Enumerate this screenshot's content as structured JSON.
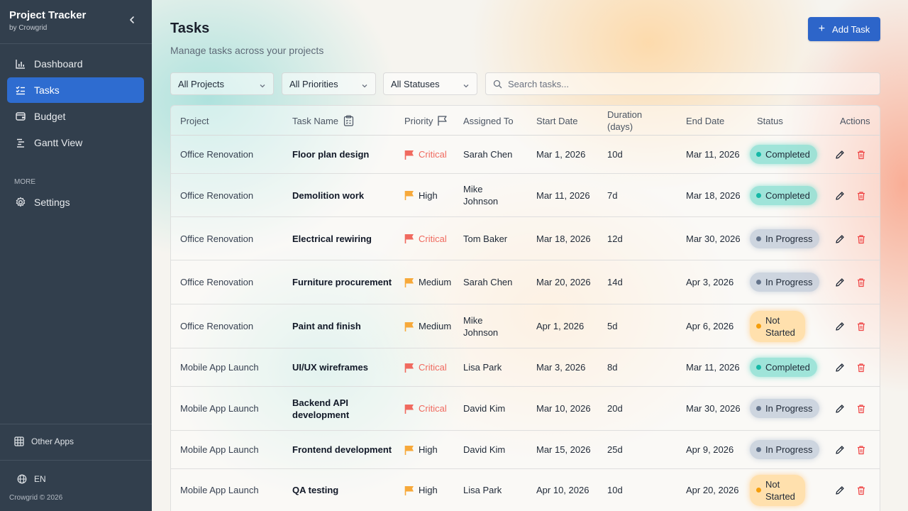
{
  "app": {
    "title": "Project Tracker",
    "subtitle": "by Crowgrid"
  },
  "sidebar": {
    "items": [
      {
        "label": "Dashboard",
        "icon": "bar-chart-icon"
      },
      {
        "label": "Tasks",
        "icon": "checklist-icon",
        "active": true
      },
      {
        "label": "Budget",
        "icon": "wallet-icon"
      },
      {
        "label": "Gantt View",
        "icon": "gantt-icon"
      }
    ],
    "section_more": "MORE",
    "more_items": [
      {
        "label": "Settings",
        "icon": "gear-icon"
      }
    ],
    "other_apps": "Other Apps",
    "language": "EN",
    "copyright": "Crowgrid © 2026"
  },
  "header": {
    "title": "Tasks",
    "subtitle": "Manage tasks across your projects",
    "add_button": "Add Task"
  },
  "filters": {
    "project": "All Projects",
    "priority": "All Priorities",
    "status": "All Statuses",
    "search_placeholder": "Search tasks..."
  },
  "table": {
    "columns": [
      "Project",
      "Task Name",
      "Priority",
      "Assigned To",
      "Start Date",
      "Duration (days)",
      "End Date",
      "Status",
      "Actions"
    ],
    "rows": [
      {
        "project": "Office Renovation",
        "task": "Floor plan design",
        "priority": "Critical",
        "assigned": "Sarah Chen",
        "start": "Mar 1, 2026",
        "duration": "10d",
        "end": "Mar 11, 2026",
        "status": "Completed"
      },
      {
        "project": "Office Renovation",
        "task": "Demolition work",
        "priority": "High",
        "assigned": "Mike Johnson",
        "start": "Mar 11, 2026",
        "duration": "7d",
        "end": "Mar 18, 2026",
        "status": "Completed"
      },
      {
        "project": "Office Renovation",
        "task": "Electrical rewiring",
        "priority": "Critical",
        "assigned": "Tom Baker",
        "start": "Mar 18, 2026",
        "duration": "12d",
        "end": "Mar 30, 2026",
        "status": "In Progress"
      },
      {
        "project": "Office Renovation",
        "task": "Furniture procurement",
        "priority": "Medium",
        "assigned": "Sarah Chen",
        "start": "Mar 20, 2026",
        "duration": "14d",
        "end": "Apr 3, 2026",
        "status": "In Progress"
      },
      {
        "project": "Office Renovation",
        "task": "Paint and finish",
        "priority": "Medium",
        "assigned": "Mike Johnson",
        "start": "Apr 1, 2026",
        "duration": "5d",
        "end": "Apr 6, 2026",
        "status": "Not Started"
      },
      {
        "project": "Mobile App Launch",
        "task": "UI/UX wireframes",
        "priority": "Critical",
        "assigned": "Lisa Park",
        "start": "Mar 3, 2026",
        "duration": "8d",
        "end": "Mar 11, 2026",
        "status": "Completed"
      },
      {
        "project": "Mobile App Launch",
        "task": "Backend API development",
        "priority": "Critical",
        "assigned": "David Kim",
        "start": "Mar 10, 2026",
        "duration": "20d",
        "end": "Mar 30, 2026",
        "status": "In Progress"
      },
      {
        "project": "Mobile App Launch",
        "task": "Frontend development",
        "priority": "High",
        "assigned": "David Kim",
        "start": "Mar 15, 2026",
        "duration": "25d",
        "end": "Apr 9, 2026",
        "status": "In Progress"
      },
      {
        "project": "Mobile App Launch",
        "task": "QA testing",
        "priority": "High",
        "assigned": "Lisa Park",
        "start": "Apr 10, 2026",
        "duration": "10d",
        "end": "Apr 20, 2026",
        "status": "Not Started"
      }
    ]
  },
  "colors": {
    "sidebar_bg": "#323f4d",
    "accent": "#2e6cd0",
    "critical": "#f06a5f",
    "high": "#f7a93a",
    "medium": "#f7a93a",
    "completed_dot": "#14b8a6",
    "progress_dot": "#64748b",
    "notstarted_dot": "#f59e0b",
    "delete_icon": "#ef4444"
  }
}
